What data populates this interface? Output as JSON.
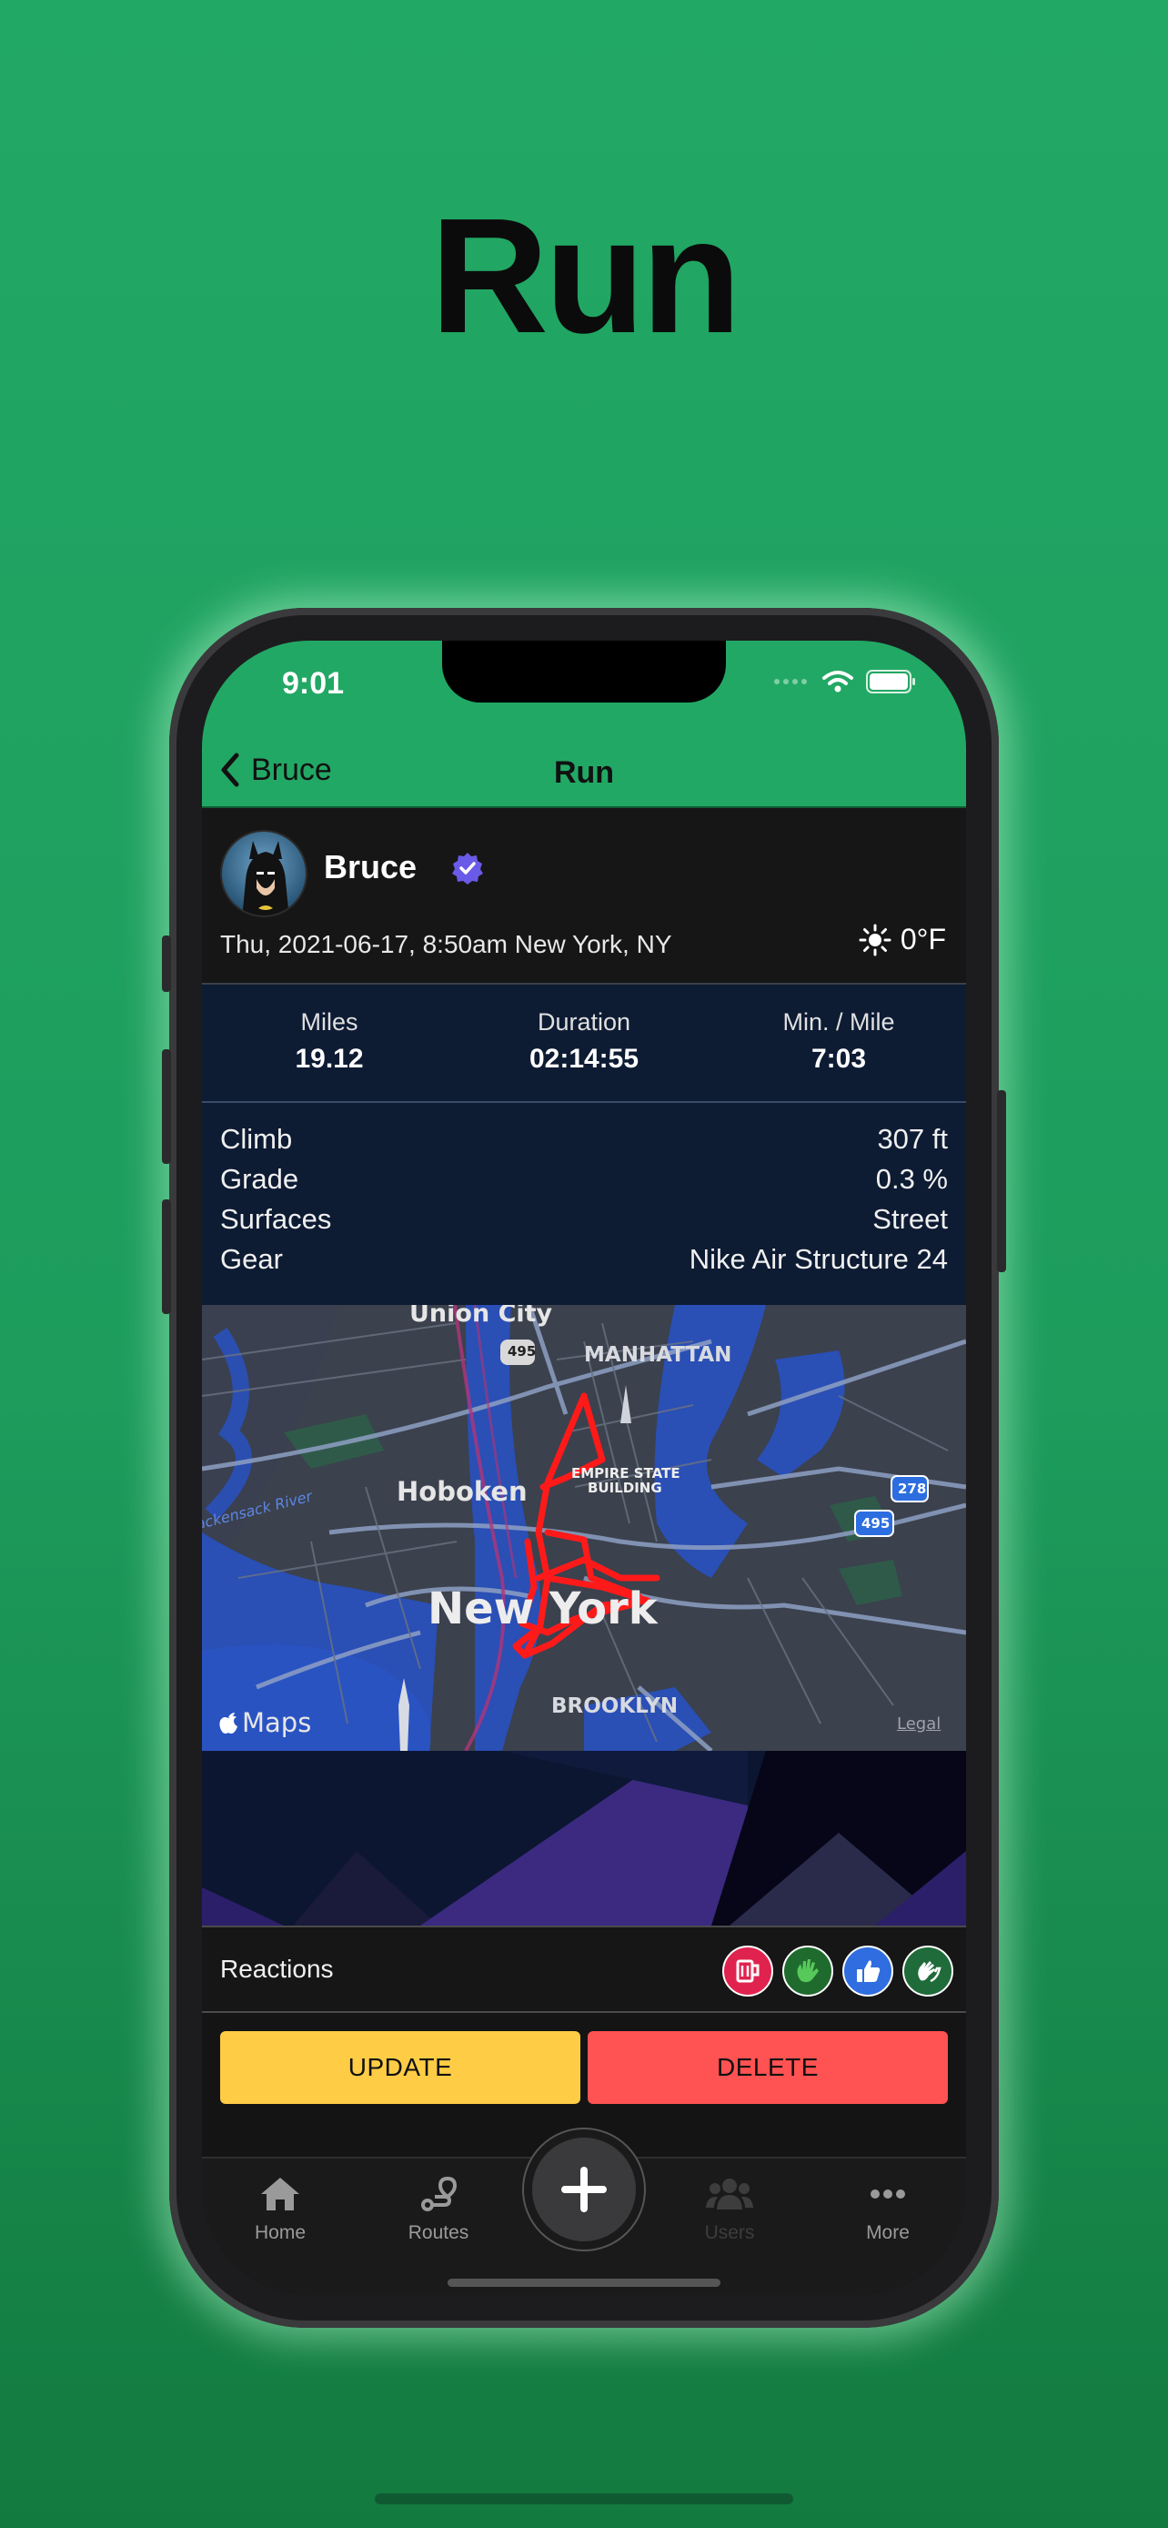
{
  "headline": "Run",
  "status_bar": {
    "time": "9:01"
  },
  "nav": {
    "back_label": "Bruce",
    "title": "Run"
  },
  "profile": {
    "name": "Bruce",
    "date_location": "Thu, 2021-06-17, 8:50am New York, NY",
    "temperature": "0°F"
  },
  "stats": [
    {
      "label": "Miles",
      "value": "19.12"
    },
    {
      "label": "Duration",
      "value": "02:14:55"
    },
    {
      "label": "Min. / Mile",
      "value": "7:03"
    }
  ],
  "details": [
    {
      "key": "Climb",
      "value": "307 ft"
    },
    {
      "key": "Grade",
      "value": "0.3 %"
    },
    {
      "key": "Surfaces",
      "value": "Street"
    },
    {
      "key": "Gear",
      "value": "Nike Air Structure 24"
    }
  ],
  "map": {
    "labels": {
      "union_city": "Union City",
      "manhattan": "MANHATTAN",
      "hoboken": "Hoboken",
      "empire_state": "EMPIRE STATE",
      "empire_state_2": "BUILDING",
      "new_york": "New York",
      "brooklyn": "BROOKLYN",
      "hackensack": "ackensack River",
      "hw_495a": "495",
      "hw_495b": "495",
      "hw_278": "278"
    },
    "attribution": "Maps",
    "legal": "Legal",
    "route_color": "#ff1a1a"
  },
  "reactions": {
    "label": "Reactions",
    "items": [
      {
        "icon": "beer-mug-icon",
        "color": "#e0234e"
      },
      {
        "icon": "waving-hand-icon",
        "color": "#1f6b2e"
      },
      {
        "icon": "thumbs-up-icon",
        "color": "#2f6de0"
      },
      {
        "icon": "clapping-hands-icon",
        "color": "#1f6b3a"
      }
    ]
  },
  "actions": {
    "update_label": "UPDATE",
    "delete_label": "DELETE",
    "update_color": "#ffcd45",
    "delete_color": "#ff5252"
  },
  "tabs": [
    {
      "label": "Home",
      "icon": "home-icon"
    },
    {
      "label": "Routes",
      "icon": "route-icon"
    },
    {
      "label": "Users",
      "icon": "users-icon"
    },
    {
      "label": "More",
      "icon": "more-icon"
    }
  ],
  "fab": {
    "icon": "plus-icon"
  }
}
